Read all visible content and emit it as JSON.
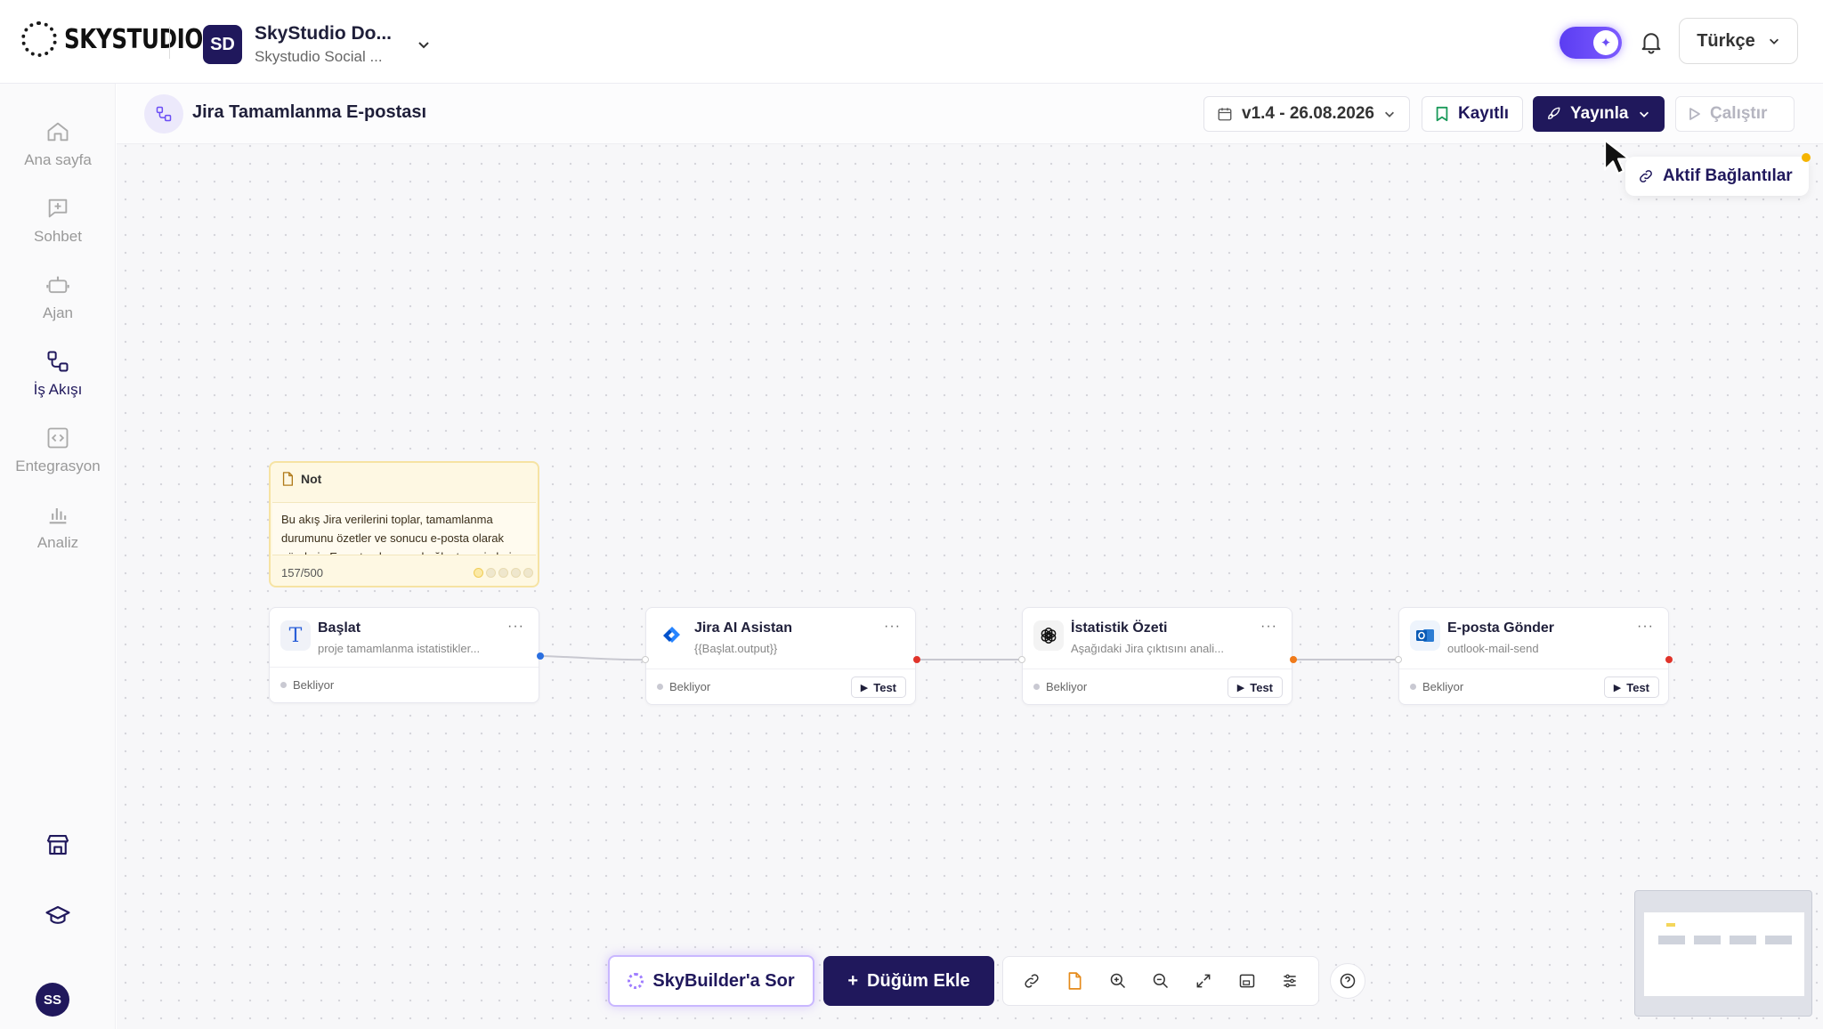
{
  "brand": {
    "logo_text": "SKYSTUDIO"
  },
  "workspace": {
    "badge": "SD",
    "name": "SkyStudio Do...",
    "subtitle": "Skystudio Social ..."
  },
  "header": {
    "language": "Türkçe"
  },
  "sidebar": {
    "items": [
      {
        "label": "Ana sayfa",
        "icon": "home-icon"
      },
      {
        "label": "Sohbet",
        "icon": "chat-icon"
      },
      {
        "label": "Ajan",
        "icon": "robot-icon"
      },
      {
        "label": "İş Akışı",
        "icon": "workflow-icon",
        "active": true
      },
      {
        "label": "Entegrasyon",
        "icon": "code-icon"
      },
      {
        "label": "Analiz",
        "icon": "chart-icon"
      }
    ],
    "avatar": "SS"
  },
  "flow": {
    "title": "Jira Tamamlanma E-postası",
    "version": "v1.4 - 26.08.2026",
    "saved_label": "Kayıtlı",
    "publish_label": "Yayınla",
    "run_label": "Çalıştır",
    "active_connections": "Aktif Bağlantılar"
  },
  "note": {
    "title": "Not",
    "body": "Bu akış Jira verilerini toplar, tamamlanma durumunu özetler ve sonucu e-posta olarak gönderir. E-posta alıcısı ve bağlantı seçimleri",
    "count": "157/500"
  },
  "nodes": [
    {
      "title": "Başlat",
      "subtitle": "proje tamamlanma istatistikler...",
      "status": "Bekliyor",
      "icon": "text-t-icon"
    },
    {
      "title": "Jira AI Asistan",
      "subtitle": "{{Başlat.output}}",
      "status": "Bekliyor",
      "test": "Test",
      "icon": "jira-icon"
    },
    {
      "title": "İstatistik Özeti",
      "subtitle": "Aşağıdaki Jira çıktısını anali...",
      "status": "Bekliyor",
      "test": "Test",
      "icon": "openai-icon"
    },
    {
      "title": "E-posta Gönder",
      "subtitle": "outlook-mail-send",
      "status": "Bekliyor",
      "test": "Test",
      "icon": "outlook-icon"
    }
  ],
  "toolbar": {
    "ask_label": "SkyBuilder'a Sor",
    "add_node_label": "Düğüm Ekle",
    "add_node_prefix": "+"
  },
  "colors": {
    "primary": "#20185c",
    "accent": "#6a4df5",
    "note_bg": "#fef8e3"
  }
}
